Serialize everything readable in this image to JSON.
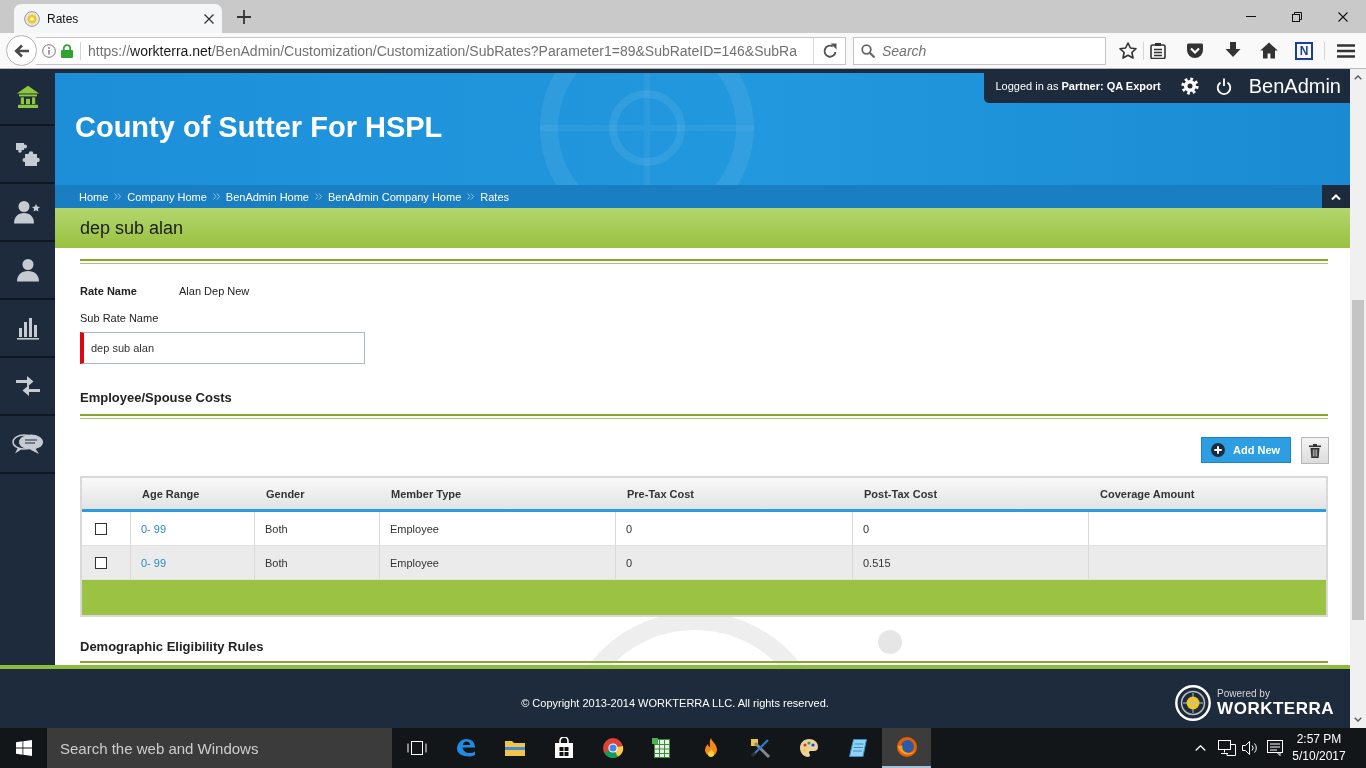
{
  "browser": {
    "tabs": [
      {
        "title": "Rates",
        "selected": true
      }
    ],
    "address": {
      "scheme": "https://",
      "host": "workterra.net",
      "path": "/BenAdmin/Customization/Customization/SubRates?Parameter1=89&SubRateID=146&SubRa"
    },
    "search": {
      "placeholder": "Search"
    },
    "extension_label": "N"
  },
  "sidebar": {
    "items": [
      {
        "kind": "home",
        "selected": true
      },
      {
        "kind": "puzzle",
        "selected": false
      },
      {
        "kind": "user-star",
        "selected": false
      },
      {
        "kind": "user",
        "selected": false
      },
      {
        "kind": "chart",
        "selected": false
      },
      {
        "kind": "transfer",
        "selected": false
      },
      {
        "kind": "chat",
        "selected": false
      }
    ]
  },
  "header": {
    "title": "County of Sutter For HSPL",
    "user": "Logged in as **Partner: QA Export**",
    "app_name": "BenAdmin"
  },
  "breadcrumb": [
    "Home",
    "Company Home",
    "BenAdmin Home",
    "BenAdmin Company Home",
    "Rates"
  ],
  "page_title": "dep sub alan",
  "rate_form": {
    "rate_name": {
      "label": "Rate Name",
      "value": "Alan Dep New"
    },
    "sub_rate_name": {
      "label": "Sub Rate Name",
      "value": "dep sub alan",
      "required": true
    }
  },
  "costs": {
    "title": "Employee/Spouse Costs",
    "add_button": "Add New",
    "table": {
      "columns": [
        "Age Range",
        "Gender",
        "Member Type",
        "Pre-Tax Cost",
        "Post-Tax Cost",
        "Coverage Amount"
      ],
      "rows": [
        {
          "checked": false,
          "cells": [
            "0- 99",
            "Both",
            "Employee",
            "0",
            "0"
          ]
        },
        {
          "checked": false,
          "cells": [
            "0- 99",
            "Both",
            "Employee",
            "0",
            "0.515"
          ]
        }
      ]
    }
  },
  "demographic_rules": {
    "title": "Demographic Eligibility Rules"
  },
  "footer": {
    "copyright": "© Copyright 2013-2014 WORKTERRA LLC. All rights reserved.",
    "powered_by": "Powered by",
    "brand": "WORKTERRA"
  },
  "taskbar": {
    "search": {
      "placeholder": "Search the web and Windows"
    },
    "apps": [
      {
        "kind": "edge",
        "selected": false
      },
      {
        "kind": "explorer",
        "selected": false
      },
      {
        "kind": "store",
        "selected": false
      },
      {
        "kind": "chrome",
        "selected": false
      },
      {
        "kind": "spreadsheet",
        "selected": false
      },
      {
        "kind": "flame",
        "selected": false
      },
      {
        "kind": "tools",
        "selected": false
      },
      {
        "kind": "paint",
        "selected": false
      },
      {
        "kind": "notepad",
        "selected": false
      },
      {
        "kind": "firefox",
        "selected": true
      }
    ],
    "time": "2:57 PM",
    "date": "5/10/2017"
  }
}
